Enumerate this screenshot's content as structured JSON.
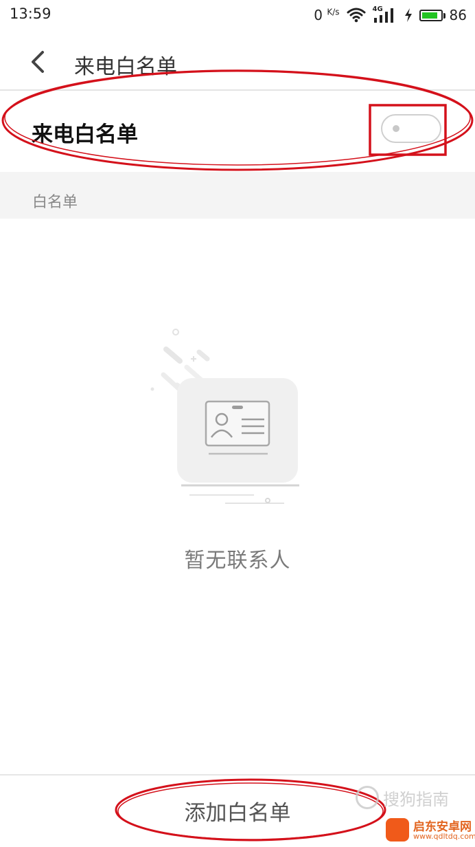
{
  "status_bar": {
    "time": "13:59",
    "net_speed_value": "0",
    "net_speed_unit": "K/s",
    "network_type": "4G",
    "battery_level": "86",
    "battery_color": "#22c322"
  },
  "header": {
    "title": "来电白名单",
    "back_icon": "chevron-left-icon"
  },
  "toggle_row": {
    "label": "来电白名单",
    "enabled": false
  },
  "section": {
    "label": "白名单"
  },
  "empty_state": {
    "icon": "contact-card-icon",
    "message": "暂无联系人"
  },
  "bottom_bar": {
    "add_button_label": "添加白名单"
  },
  "annotations": {
    "color": "#d4111b"
  },
  "watermarks": {
    "sougou_text": "搜狗指南",
    "qidong_title": "启东安卓网",
    "qidong_url": "www.qdltdq.com"
  }
}
